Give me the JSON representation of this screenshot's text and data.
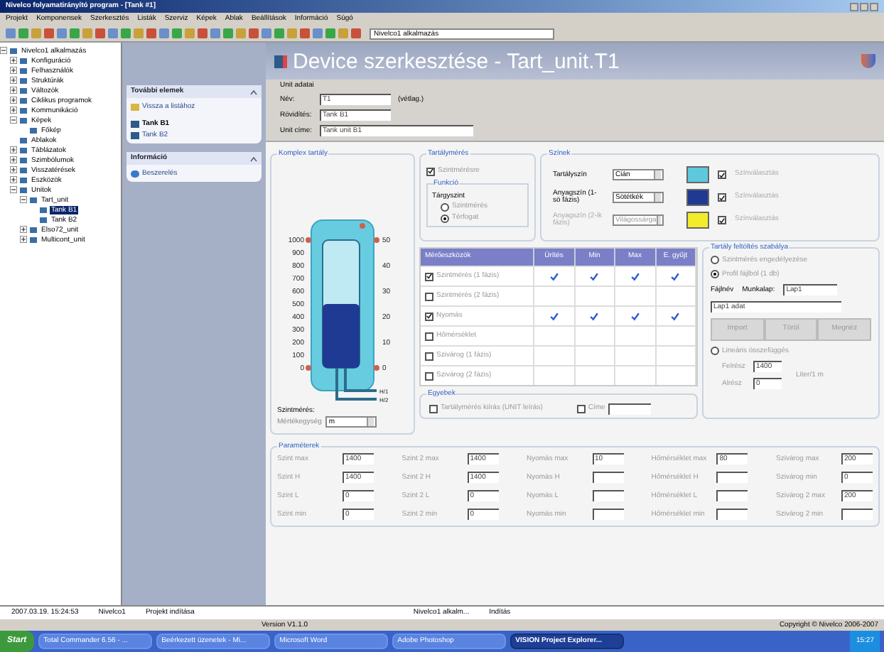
{
  "window": {
    "title": "Nivelco folyamatirányító program - [Tank #1]"
  },
  "menu": [
    "Projekt",
    "Komponensek",
    "Szerkesztés",
    "Listák",
    "Szerviz",
    "Képek",
    "Ablak",
    "Beállítások",
    "Információ",
    "Súgó"
  ],
  "toolbar": {
    "app_combo": "Nivelco1 alkalmazás"
  },
  "tree": [
    {
      "label": "Nivelco1 alkalmazás",
      "expanded": true,
      "selected": false,
      "children": [
        {
          "label": "Konfiguráció",
          "expanded": false,
          "selected": false
        },
        {
          "label": "Felhasználók",
          "expanded": false,
          "selected": false
        },
        {
          "label": "Struktúrák",
          "expanded": false,
          "selected": false
        },
        {
          "label": "Változók",
          "expanded": false,
          "selected": false
        },
        {
          "label": "Ciklikus programok",
          "expanded": false,
          "selected": false
        },
        {
          "label": "Kommunikáció",
          "expanded": false,
          "selected": false
        },
        {
          "label": "Képek",
          "expanded": true,
          "selected": false,
          "children": [
            {
              "label": "Főkép",
              "selected": false
            }
          ]
        },
        {
          "label": "Ablakok",
          "selected": false
        },
        {
          "label": "Táblázatok",
          "expanded": false,
          "selected": false
        },
        {
          "label": "Szimbólumok",
          "expanded": false,
          "selected": false
        },
        {
          "label": "Visszatérések",
          "expanded": false,
          "selected": false
        },
        {
          "label": "Eszközök",
          "expanded": false,
          "selected": false
        },
        {
          "label": "Unitok",
          "expanded": true,
          "selected": false,
          "children": [
            {
              "label": "Tart_unit",
              "expanded": true,
              "selected": false,
              "children": [
                {
                  "label": "Tank B1",
                  "selected": true
                },
                {
                  "label": "Tank B2",
                  "selected": false
                }
              ]
            },
            {
              "label": "Elso72_unit",
              "expanded": false,
              "selected": false
            },
            {
              "label": "Multicont_unit",
              "expanded": false,
              "selected": false
            }
          ]
        }
      ]
    }
  ],
  "nav_panel": [
    {
      "title": "További elemek",
      "items": [
        {
          "label": "Vissza a listához",
          "kind": "link"
        },
        {
          "label": "Tank B1",
          "kind": "current"
        },
        {
          "label": "Tank B2",
          "kind": "unit"
        }
      ]
    },
    {
      "title": "Információ",
      "items": [
        {
          "label": "Beszerelés",
          "kind": "info"
        }
      ]
    }
  ],
  "header": {
    "title": "Device szerkesztése - Tart_unit.T1"
  },
  "unit_data": {
    "title": "Unit adatai",
    "fields": [
      {
        "label": "Név:",
        "value": "T1",
        "note": "(vétlag.)"
      },
      {
        "label": "Rövidítés:",
        "value": "Tank B1"
      },
      {
        "label": "Unit címe:",
        "value": "Tank unit B1"
      }
    ]
  },
  "tank": {
    "title": "Komplex tartály",
    "level": 0.5,
    "left_scale": [
      "1000",
      "900",
      "800",
      "700",
      "600",
      "500",
      "400",
      "300",
      "200",
      "100",
      "0"
    ],
    "right_scale": [
      "50",
      "40",
      "30",
      "20",
      "10",
      "0"
    ],
    "outputs": [
      "H/1",
      "H/2"
    ],
    "unit_label": "Szintmérés:",
    "unit_caption": "Mértékegység",
    "unit_value": "m"
  },
  "measurement": {
    "title": "Tartálymérés",
    "checkbox": {
      "label": "Szintmérésre",
      "checked": true
    },
    "group": "Funkció",
    "target": "Tárgyszint",
    "options": [
      {
        "label": "Szintmérés",
        "selected": false
      },
      {
        "label": "Térfogat",
        "selected": true
      }
    ]
  },
  "colors": {
    "title": "Színek",
    "rows": [
      {
        "label": "Tartályszín",
        "value": "Cián",
        "color": "#5ec8dc",
        "disabled": false,
        "check_label": "Színválasztás",
        "checked": true
      },
      {
        "label": "Anyagszín (1-sö fázis)",
        "value": "Sötétkék",
        "color": "#1f3a93",
        "disabled": false,
        "check_label": "Színválasztás",
        "checked": true
      },
      {
        "label": "Anyagszín (2-ik fázis)",
        "value": "Világossárga",
        "color": "#f2ec2a",
        "disabled": true,
        "check_label": "Színválasztás",
        "checked": true
      }
    ]
  },
  "instruments": {
    "columns": [
      "Mérőeszközök",
      "Ürítés",
      "Min",
      "Max",
      "E. gyűjt"
    ],
    "rows": [
      {
        "label": "Szintmérés (1 fázis)",
        "checked": true,
        "marks": [
          true,
          true,
          true,
          true
        ]
      },
      {
        "label": "Szintmérés (2 fázis)",
        "checked": false,
        "marks": [
          false,
          false,
          false,
          false
        ]
      },
      {
        "label": "Nyomás",
        "checked": true,
        "marks": [
          true,
          true,
          true,
          true
        ]
      },
      {
        "label": "Hőmérséklet",
        "checked": false,
        "marks": [
          false,
          false,
          false,
          false
        ]
      },
      {
        "label": "Szivárog (1 fázis)",
        "checked": false,
        "marks": [
          false,
          false,
          false,
          false
        ]
      },
      {
        "label": "Szivárog (2 fázis)",
        "checked": false,
        "marks": [
          false,
          false,
          false,
          false
        ]
      }
    ]
  },
  "other": {
    "title": "Egyebek",
    "items": [
      {
        "label": "Tartálymérés kiírás (UNIT leírás)",
        "checked": false
      },
      {
        "label": "Címe",
        "checked": false
      }
    ]
  },
  "filling": {
    "title": "Tartály feltöltés szabálya",
    "options": [
      {
        "label": "Szintmérés engedélyezése",
        "selected": false
      },
      {
        "label": "Profil fájlból (1 db)",
        "selected": true
      },
      {
        "label": "Lineáris összefüggés",
        "selected": false
      }
    ],
    "file_label": "Fájlnév",
    "sheet_label": "Munkalap:",
    "sheet_value": "Lap1",
    "data_value": "Lap1 adat",
    "buttons": [
      "Import",
      "Töröl",
      "Megnéz"
    ],
    "linear": [
      {
        "label": "Felrész",
        "value": "1400"
      },
      {
        "label": "Alrész",
        "value": "0"
      }
    ],
    "linear_unit": "Liter/1 m"
  },
  "parameters": {
    "title": "Paraméterek",
    "columns": [
      [
        {
          "label": "Szint max",
          "value": "1400"
        },
        {
          "label": "Szint H",
          "value": "1400"
        },
        {
          "label": "Szint L",
          "value": "0"
        },
        {
          "label": "Szint min",
          "value": "0"
        }
      ],
      [
        {
          "label": "Szint 2 max",
          "value": "1400"
        },
        {
          "label": "Szint 2 H",
          "value": "1400"
        },
        {
          "label": "Szint 2 L",
          "value": "0"
        },
        {
          "label": "Szint 2 min",
          "value": "0"
        }
      ],
      [
        {
          "label": "Nyomás max",
          "value": "10"
        },
        {
          "label": "Nyomás H"
        },
        {
          "label": "Nyomás L"
        },
        {
          "label": "Nyomás min"
        }
      ],
      [
        {
          "label": "Hőmérséklet max",
          "value": "80"
        },
        {
          "label": "Hőmérséklet H"
        },
        {
          "label": "Hőmérséklet L"
        },
        {
          "label": "Hőmérséklet min"
        }
      ],
      [
        {
          "label": "Szivárog max",
          "value": "200"
        },
        {
          "label": "Szivárog min",
          "value": "0"
        },
        {
          "label": "Szivárog 2 max",
          "value": "200"
        },
        {
          "label": "Szivárog 2 min"
        }
      ]
    ]
  },
  "status_bar": [
    "2007.03.19. 15:24:53",
    "Nivelco1",
    "Projekt indítása",
    "Nivelco1 alkalm...",
    "Indítás"
  ],
  "version_bar": {
    "version": "Version V1.1.0",
    "copyright": "Copyright © Nivelco 2006-2007"
  },
  "taskbar": {
    "start": "Start",
    "tasks": [
      {
        "label": "Total Commander 6.56 - ...",
        "selected": false
      },
      {
        "label": "Beérkezett üzenetek - Mi...",
        "selected": false
      },
      {
        "label": "Microsoft Word",
        "selected": false
      },
      {
        "label": "Adobe Photoshop",
        "selected": false
      },
      {
        "label": "VISION Project Explorer...",
        "selected": true
      }
    ],
    "clock": "15:27"
  }
}
